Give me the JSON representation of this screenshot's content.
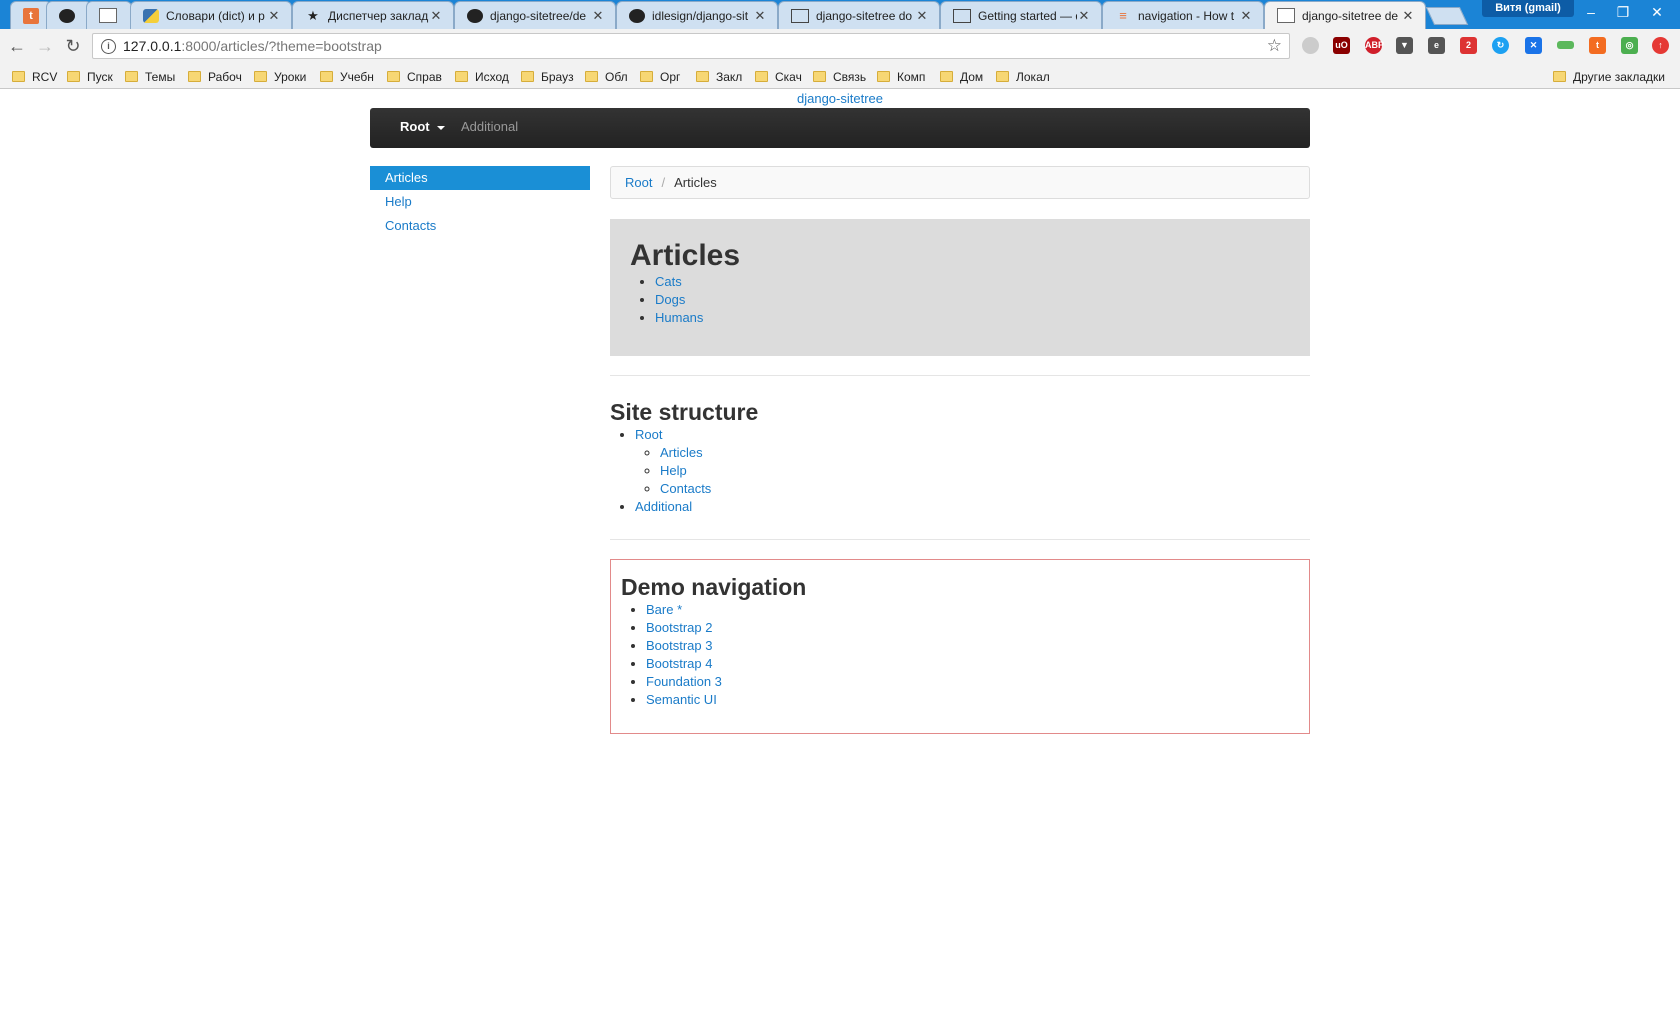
{
  "browser": {
    "tabs": [
      {
        "label": "",
        "icon": "t",
        "color": "#e8743b"
      },
      {
        "label": "",
        "icon": "github"
      },
      {
        "label": "",
        "icon": "page"
      },
      {
        "label": "Словари (dict) и р",
        "icon": "python"
      },
      {
        "label": "Диспетчер заклад",
        "icon": "star"
      },
      {
        "label": "django-sitetree/de",
        "icon": "github"
      },
      {
        "label": "idlesign/django-sit",
        "icon": "github"
      },
      {
        "label": "django-sitetree do",
        "icon": "doc"
      },
      {
        "label": "Getting started — d",
        "icon": "doc"
      },
      {
        "label": "navigation - How t",
        "icon": "stackoverflow"
      },
      {
        "label": "django-sitetree de",
        "icon": "page",
        "active": true
      }
    ],
    "profile": "Витя (gmail)",
    "url_host": "127.0.0.1",
    "url_rest": ":8000/articles/?theme=bootstrap",
    "bookmarks": [
      "RCV",
      "Пуск",
      "Темы",
      "Рабоч",
      "Уроки",
      "Учебн",
      "Справ",
      "Исход",
      "Брауз",
      "Обл",
      "Орг",
      "Закл",
      "Скач",
      "Связь",
      "Комп",
      "Дом",
      "Локал"
    ],
    "other_bookmarks": "Другие закладки"
  },
  "page": {
    "site_title": "django-sitetree",
    "navbar": {
      "root": "Root",
      "additional": "Additional"
    },
    "sidebar": [
      "Articles",
      "Help",
      "Contacts"
    ],
    "breadcrumb": {
      "root": "Root",
      "sep": "/",
      "current": "Articles"
    },
    "jumbotron": {
      "title": "Articles",
      "items": [
        "Cats",
        "Dogs",
        "Humans"
      ]
    },
    "structure": {
      "title": "Site structure",
      "root": "Root",
      "children": [
        "Articles",
        "Help",
        "Contacts"
      ],
      "additional": "Additional"
    },
    "demo": {
      "title": "Demo navigation",
      "items": [
        "Bare *",
        "Bootstrap 2",
        "Bootstrap 3",
        "Bootstrap 4",
        "Foundation 3",
        "Semantic UI"
      ]
    }
  }
}
